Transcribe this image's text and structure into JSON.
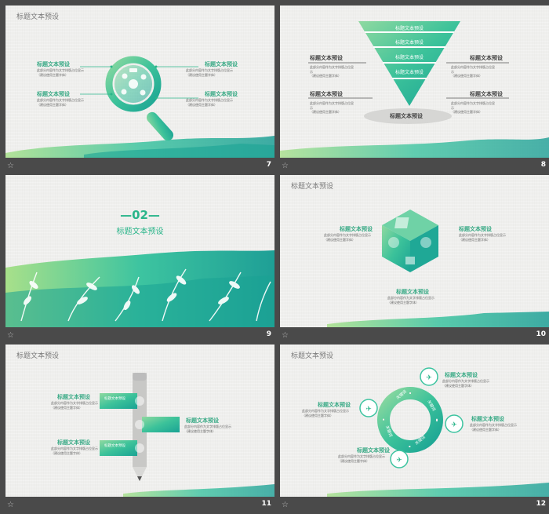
{
  "colors": {
    "bg": "#4a4a4a",
    "slide": "#efefed",
    "accent": "#2ab58a",
    "accent_light": "#7fd6b4",
    "text": "#666666"
  },
  "icons": {
    "strip": "star-icon"
  },
  "slides": [
    {
      "number": "7",
      "title": "标题文本预设",
      "items": [
        {
          "title": "标题文本预设",
          "desc1": "此部分内容作为文字排版占位显示",
          "desc2": "（建议使用主题字体）"
        },
        {
          "title": "标题文本预设",
          "desc1": "此部分内容作为文字排版占位显示",
          "desc2": "（建议使用主题字体）"
        },
        {
          "title": "标题文本预设",
          "desc1": "此部分内容作为文字排版占位显示",
          "desc2": "（建议使用主题字体）"
        },
        {
          "title": "标题文本预设",
          "desc1": "此部分内容作为文字排版占位显示",
          "desc2": "（建议使用主题字体）"
        }
      ]
    },
    {
      "number": "8",
      "funnel": [
        "标题文本预设",
        "标题文本预设",
        "标题文本预设",
        "标题文本预设"
      ],
      "ellipse": "标题文本预设",
      "items": [
        {
          "title": "标题文本预设",
          "desc1": "此部分内容作为文字排版占位显",
          "desc2": "示",
          "desc3": "（建议使用主题字体）"
        },
        {
          "title": "标题文本预设",
          "desc1": "此部分内容作为文字排版占位显",
          "desc2": "示",
          "desc3": "（建议使用主题字体）"
        },
        {
          "title": "标题文本预设",
          "desc1": "此部分内容作为文字排版占位显",
          "desc2": "示",
          "desc3": "（建议使用主题字体）"
        },
        {
          "title": "标题文本预设",
          "desc1": "此部分内容作为文字排版占位显",
          "desc2": "示",
          "desc3": "（建议使用主题字体）"
        }
      ]
    },
    {
      "number": "9",
      "section": "—02—",
      "section_title": "标题文本预设"
    },
    {
      "number": "10",
      "title": "标题文本预设",
      "items": [
        {
          "title": "标题文本预设",
          "desc1": "此部分内容作为文字排版占位显示",
          "desc2": "（建议使用主题字体）"
        },
        {
          "title": "标题文本预设",
          "desc1": "此部分内容作为文字排版占位显示",
          "desc2": "（建议使用主题字体）"
        },
        {
          "title": "标题文本预设",
          "desc1": "此部分内容作为文字排版占位显示",
          "desc2": "（建议使用主题字体）"
        }
      ]
    },
    {
      "number": "11",
      "title": "标题文本预设",
      "tags": [
        "标题文本预设",
        "标题文本预设"
      ],
      "items": [
        {
          "title": "标题文本预设",
          "desc1": "此部分内容作为文字排版占位显示",
          "desc2": "（建议使用主题字体）"
        },
        {
          "title": "标题文本预设",
          "desc1": "此部分内容作为文字排版占位显示",
          "desc2": "（建议使用主题字体）"
        },
        {
          "title": "标题文本预设",
          "desc1": "此部分内容作为文字排版占位显示",
          "desc2": "（建议使用主题字体）"
        }
      ]
    },
    {
      "number": "12",
      "title": "标题文本预设",
      "ring": [
        "关键词",
        "关键词",
        "关键词",
        "关键词"
      ],
      "items": [
        {
          "title": "标题文本预设",
          "desc1": "此部分内容作为文字排版占位显示",
          "desc2": "（建议使用主题字体）"
        },
        {
          "title": "标题文本预设",
          "desc1": "此部分内容作为文字排版占位显示",
          "desc2": "（建议使用主题字体）"
        },
        {
          "title": "标题文本预设",
          "desc1": "此部分内容作为文字排版占位显示",
          "desc2": "（建议使用主题字体）"
        },
        {
          "title": "标题文本预设",
          "desc1": "此部分内容作为文字排版占位显示",
          "desc2": "（建议使用主题字体）"
        }
      ]
    }
  ]
}
